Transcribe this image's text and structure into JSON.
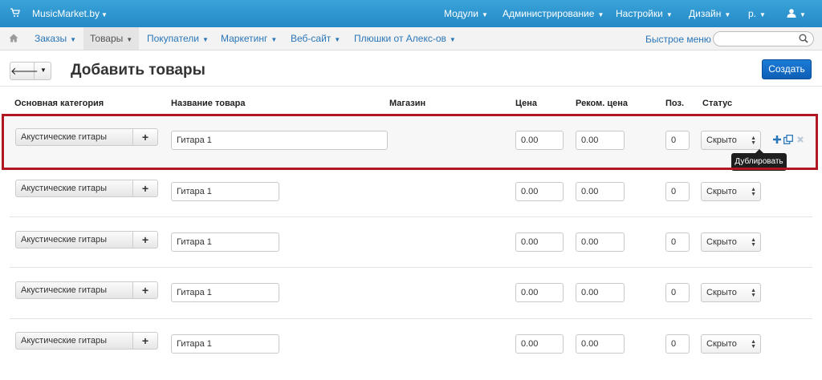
{
  "topbar": {
    "brand": "MusicMarket.by",
    "menu": [
      {
        "label": "Модули"
      },
      {
        "label": "Администрирование"
      },
      {
        "label": "Настройки"
      },
      {
        "label": "Дизайн"
      },
      {
        "label": "р."
      }
    ]
  },
  "subnav": {
    "items": [
      {
        "label": "Заказы"
      },
      {
        "label": "Товары"
      },
      {
        "label": "Покупатели"
      },
      {
        "label": "Маркетинг"
      },
      {
        "label": "Веб-сайт"
      },
      {
        "label": "Плюшки от Алекс-ов"
      }
    ],
    "quick_menu": "Быстрое меню",
    "search_placeholder": ""
  },
  "page": {
    "title": "Добавить товары",
    "create_label": "Создать"
  },
  "columns": {
    "category": "Основная категория",
    "name": "Название товара",
    "store": "Магазин",
    "price": "Цена",
    "rec_price": "Реком. цена",
    "pos": "Поз.",
    "status": "Статус"
  },
  "rows": [
    {
      "category": "Акустические гитары",
      "name": "Гитара 1",
      "price": "0.00",
      "rec_price": "0.00",
      "pos": "0",
      "status": "Скрыто"
    },
    {
      "category": "Акустические гитары",
      "name": "Гитара 1",
      "price": "0.00",
      "rec_price": "0.00",
      "pos": "0",
      "status": "Скрыто"
    },
    {
      "category": "Акустические гитары",
      "name": "Гитара 1",
      "price": "0.00",
      "rec_price": "0.00",
      "pos": "0",
      "status": "Скрыто"
    },
    {
      "category": "Акустические гитары",
      "name": "Гитара 1",
      "price": "0.00",
      "rec_price": "0.00",
      "pos": "0",
      "status": "Скрыто"
    },
    {
      "category": "Акустические гитары",
      "name": "Гитара 1",
      "price": "0.00",
      "rec_price": "0.00",
      "pos": "0",
      "status": "Скрыто"
    }
  ],
  "tooltip": "Дублировать",
  "colors": {
    "topbar": "#2489c7",
    "primary_button": "#1167c4",
    "highlight_border": "#b0171f",
    "link": "#2a76b8"
  }
}
